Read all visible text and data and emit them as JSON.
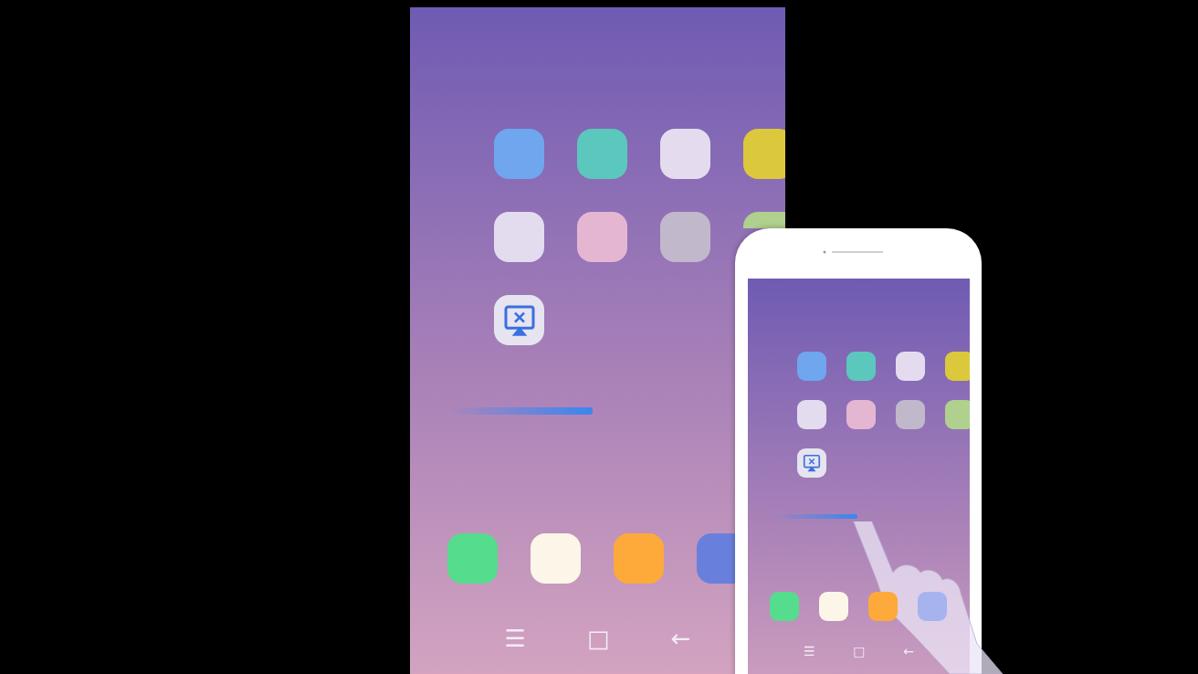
{
  "tv_screen": {
    "apps": [
      {
        "color": "#6fa6ee"
      },
      {
        "color": "#5cc7bd"
      },
      {
        "color": "#e4dcee"
      },
      {
        "color": "#dcc83c"
      },
      {
        "color": "#e3dcef"
      },
      {
        "color": "#e5b6d2"
      },
      {
        "color": "#c1b8cb"
      },
      {
        "color": "#b0d08e"
      }
    ],
    "dock": [
      {
        "color": "#55dc8c"
      },
      {
        "color": "#fbf6e8"
      },
      {
        "color": "#fdaa3a"
      },
      {
        "color": "#6880dc"
      }
    ],
    "nav_keys": [
      "☰",
      "□",
      "←"
    ]
  },
  "phone": {
    "apps": [
      {
        "color": "#6fa6ee"
      },
      {
        "color": "#5cc7bd"
      },
      {
        "color": "#e4dcee"
      },
      {
        "color": "#dcc83c"
      },
      {
        "color": "#e3dcef"
      },
      {
        "color": "#e5b6d2"
      },
      {
        "color": "#c1b8cb"
      },
      {
        "color": "#b0d08e"
      }
    ],
    "dock": [
      {
        "color": "#55dc8c"
      },
      {
        "color": "#fbf6e8"
      },
      {
        "color": "#fdaa3a"
      },
      {
        "color": "#a7b3ee"
      }
    ],
    "nav_keys": [
      "☰",
      "□",
      "←"
    ]
  }
}
